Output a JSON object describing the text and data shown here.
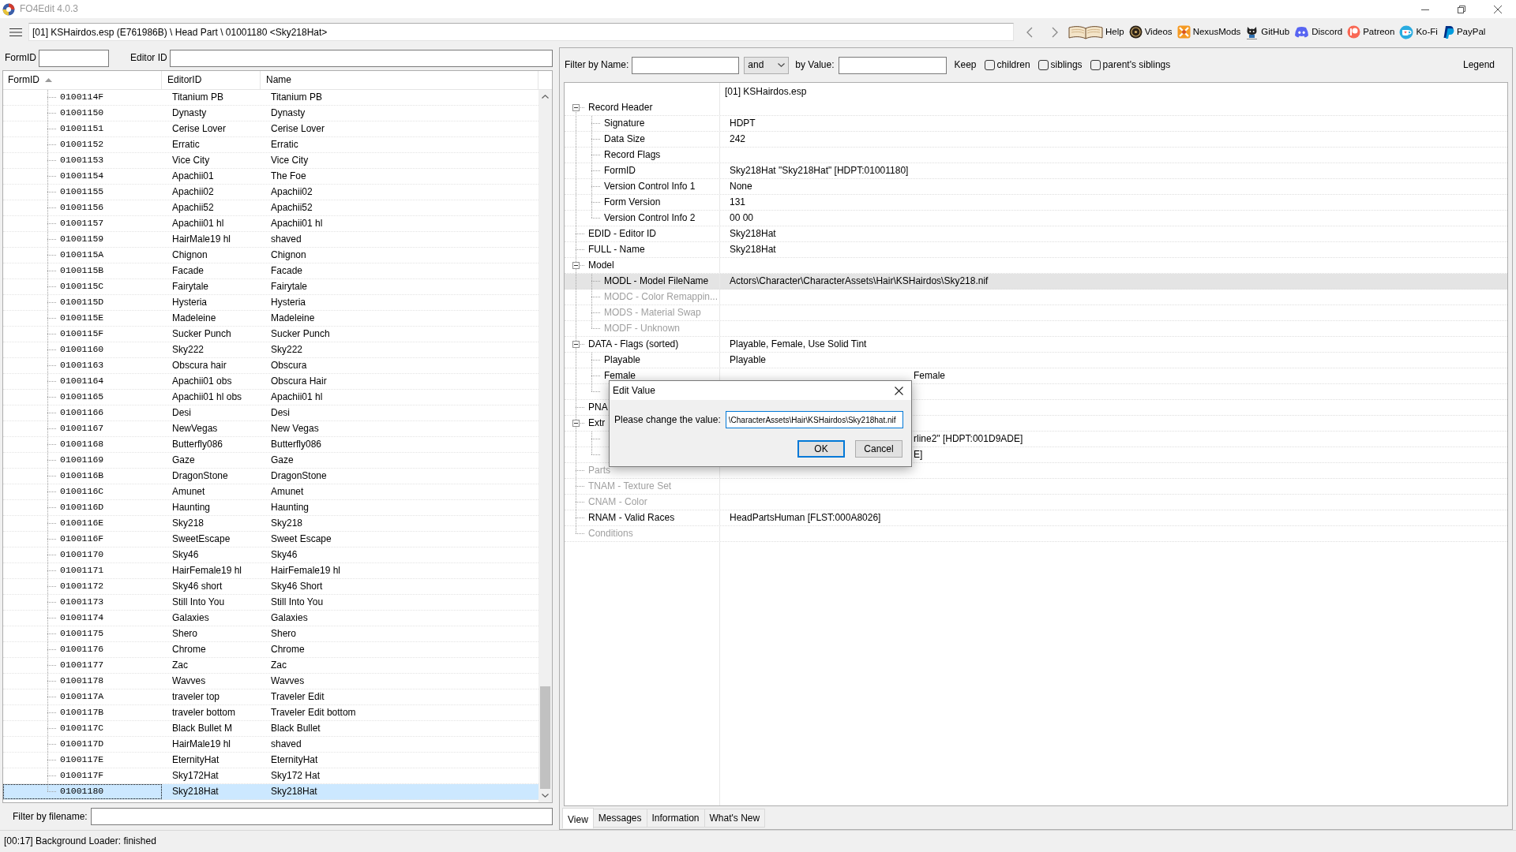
{
  "window": {
    "title": "FO4Edit 4.0.3"
  },
  "toolbar": {
    "path": "[01] KSHairdos.esp (E761986B) \\ Head Part \\ 01001180 <Sky218Hat>",
    "links": [
      {
        "kind": "help",
        "label": "Help"
      },
      {
        "kind": "videos",
        "label": "Videos"
      },
      {
        "kind": "nexusmods",
        "label": "NexusMods"
      },
      {
        "kind": "github",
        "label": "GitHub"
      },
      {
        "kind": "discord",
        "label": "Discord"
      },
      {
        "kind": "patreon",
        "label": "Patreon"
      },
      {
        "kind": "kofi",
        "label": "Ko-Fi"
      },
      {
        "kind": "paypal",
        "label": "PayPal"
      }
    ]
  },
  "record_filter": {
    "form_id_label": "FormID",
    "editor_id_label": "Editor ID"
  },
  "records": {
    "columns": [
      {
        "label": "FormID",
        "sorted": true
      },
      {
        "label": "EditorID",
        "sorted": false
      },
      {
        "label": "Name",
        "sorted": false
      }
    ],
    "rows": [
      {
        "form_id": "0100114F",
        "editor_id": "Titanium PB",
        "name": "Titanium PB",
        "selected": false
      },
      {
        "form_id": "01001150",
        "editor_id": "Dynasty",
        "name": "Dynasty",
        "selected": false
      },
      {
        "form_id": "01001151",
        "editor_id": "Cerise Lover",
        "name": "Cerise Lover",
        "selected": false
      },
      {
        "form_id": "01001152",
        "editor_id": "Erratic",
        "name": "Erratic",
        "selected": false
      },
      {
        "form_id": "01001153",
        "editor_id": "Vice City",
        "name": "Vice City",
        "selected": false
      },
      {
        "form_id": "01001154",
        "editor_id": "Apachii01",
        "name": "The Foe",
        "selected": false
      },
      {
        "form_id": "01001155",
        "editor_id": "Apachii02",
        "name": "Apachii02",
        "selected": false
      },
      {
        "form_id": "01001156",
        "editor_id": "Apachii52",
        "name": "Apachii52",
        "selected": false
      },
      {
        "form_id": "01001157",
        "editor_id": "Apachii01 hl",
        "name": "Apachii01 hl",
        "selected": false
      },
      {
        "form_id": "01001159",
        "editor_id": "HairMale19 hl",
        "name": "shaved",
        "selected": false
      },
      {
        "form_id": "0100115A",
        "editor_id": "Chignon",
        "name": "Chignon",
        "selected": false
      },
      {
        "form_id": "0100115B",
        "editor_id": "Facade",
        "name": "Facade",
        "selected": false
      },
      {
        "form_id": "0100115C",
        "editor_id": "Fairytale",
        "name": "Fairytale",
        "selected": false
      },
      {
        "form_id": "0100115D",
        "editor_id": "Hysteria",
        "name": "Hysteria",
        "selected": false
      },
      {
        "form_id": "0100115E",
        "editor_id": "Madeleine",
        "name": "Madeleine",
        "selected": false
      },
      {
        "form_id": "0100115F",
        "editor_id": "Sucker Punch",
        "name": "Sucker Punch",
        "selected": false
      },
      {
        "form_id": "01001160",
        "editor_id": "Sky222",
        "name": "Sky222",
        "selected": false
      },
      {
        "form_id": "01001163",
        "editor_id": "Obscura hair",
        "name": "Obscura",
        "selected": false
      },
      {
        "form_id": "01001164",
        "editor_id": "Apachii01 obs",
        "name": "Obscura Hair",
        "selected": false
      },
      {
        "form_id": "01001165",
        "editor_id": "Apachii01 hl obs",
        "name": "Apachii01 hl",
        "selected": false
      },
      {
        "form_id": "01001166",
        "editor_id": "Desi",
        "name": "Desi",
        "selected": false
      },
      {
        "form_id": "01001167",
        "editor_id": "NewVegas",
        "name": "New Vegas",
        "selected": false
      },
      {
        "form_id": "01001168",
        "editor_id": "Butterfly086",
        "name": "Butterfly086",
        "selected": false
      },
      {
        "form_id": "01001169",
        "editor_id": "Gaze",
        "name": "Gaze",
        "selected": false
      },
      {
        "form_id": "0100116B",
        "editor_id": "DragonStone",
        "name": "DragonStone",
        "selected": false
      },
      {
        "form_id": "0100116C",
        "editor_id": "Amunet",
        "name": "Amunet",
        "selected": false
      },
      {
        "form_id": "0100116D",
        "editor_id": "Haunting",
        "name": "Haunting",
        "selected": false
      },
      {
        "form_id": "0100116E",
        "editor_id": "Sky218",
        "name": "Sky218",
        "selected": false
      },
      {
        "form_id": "0100116F",
        "editor_id": "SweetEscape",
        "name": "Sweet Escape",
        "selected": false
      },
      {
        "form_id": "01001170",
        "editor_id": "Sky46",
        "name": "Sky46",
        "selected": false
      },
      {
        "form_id": "01001171",
        "editor_id": "HairFemale19 hl",
        "name": "HairFemale19 hl",
        "selected": false
      },
      {
        "form_id": "01001172",
        "editor_id": "Sky46 short",
        "name": "Sky46 Short",
        "selected": false
      },
      {
        "form_id": "01001173",
        "editor_id": "Still Into You",
        "name": "Still Into You",
        "selected": false
      },
      {
        "form_id": "01001174",
        "editor_id": "Galaxies",
        "name": "Galaxies",
        "selected": false
      },
      {
        "form_id": "01001175",
        "editor_id": "Shero",
        "name": "Shero",
        "selected": false
      },
      {
        "form_id": "01001176",
        "editor_id": "Chrome",
        "name": "Chrome",
        "selected": false
      },
      {
        "form_id": "01001177",
        "editor_id": "Zac",
        "name": "Zac",
        "selected": false
      },
      {
        "form_id": "01001178",
        "editor_id": "Wavves",
        "name": "Wavves",
        "selected": false
      },
      {
        "form_id": "0100117A",
        "editor_id": "traveler top",
        "name": "Traveler Edit",
        "selected": false
      },
      {
        "form_id": "0100117B",
        "editor_id": "traveler bottom",
        "name": "Traveler Edit bottom",
        "selected": false
      },
      {
        "form_id": "0100117C",
        "editor_id": "Black Bullet M",
        "name": "Black Bullet",
        "selected": false
      },
      {
        "form_id": "0100117D",
        "editor_id": "HairMale19 hl",
        "name": "shaved",
        "selected": false
      },
      {
        "form_id": "0100117E",
        "editor_id": "EternityHat",
        "name": "EternityHat",
        "selected": false
      },
      {
        "form_id": "0100117F",
        "editor_id": "Sky172Hat",
        "name": "Sky172 Hat",
        "selected": false
      },
      {
        "form_id": "01001180",
        "editor_id": "Sky218Hat",
        "name": "Sky218Hat",
        "selected": true
      }
    ]
  },
  "file_filter": {
    "label": "Filter by filename:"
  },
  "view_filter": {
    "name_label": "Filter by Name:",
    "operator": "and",
    "value_label": "by Value:",
    "keep_label": "Keep",
    "keep_options": [
      {
        "label": "children",
        "checked": false
      },
      {
        "label": "siblings",
        "checked": false
      },
      {
        "label": "parent's siblings",
        "checked": false
      }
    ],
    "legend": "Legend"
  },
  "record_view": {
    "header": "[01] KSHairdos.esp",
    "nodes": [
      {
        "label": "Record Header",
        "expanded": true,
        "selected": false,
        "disabled": false,
        "children": [
          {
            "label": "Signature",
            "value": "HDPT",
            "selected": false,
            "disabled": false
          },
          {
            "label": "Data Size",
            "value": "242",
            "selected": false,
            "disabled": false
          },
          {
            "label": "Record Flags",
            "selected": false,
            "disabled": false
          },
          {
            "label": "FormID",
            "value": "Sky218Hat \"Sky218Hat\" [HDPT:01001180]",
            "selected": false,
            "disabled": false
          },
          {
            "label": "Version Control Info 1",
            "value": "None",
            "selected": false,
            "disabled": false
          },
          {
            "label": "Form Version",
            "value": "131",
            "selected": false,
            "disabled": false
          },
          {
            "label": "Version Control Info 2",
            "value": "00 00",
            "selected": false,
            "disabled": false
          }
        ]
      },
      {
        "label": "EDID - Editor ID",
        "value": "Sky218Hat",
        "selected": false,
        "disabled": false
      },
      {
        "label": "FULL - Name",
        "value": "Sky218Hat",
        "selected": false,
        "disabled": false
      },
      {
        "label": "Model",
        "expanded": true,
        "selected": false,
        "disabled": false,
        "children": [
          {
            "label": "MODL - Model FileName",
            "value": "Actors\\Character\\CharacterAssets\\Hair\\KSHairdos\\Sky218.nif",
            "selected": true,
            "disabled": false
          },
          {
            "label": "MODC - Color Remappin...",
            "selected": false,
            "disabled": true
          },
          {
            "label": "MODS - Material Swap",
            "selected": false,
            "disabled": true
          },
          {
            "label": "MODF - Unknown",
            "selected": false,
            "disabled": true
          }
        ]
      },
      {
        "label": "DATA - Flags (sorted)",
        "value": "Playable, Female, Use Solid Tint",
        "expanded": true,
        "selected": false,
        "disabled": false,
        "children": [
          {
            "label": "Playable",
            "value": "Playable",
            "selected": false,
            "disabled": false
          },
          {
            "label": "Female",
            "value": "Female",
            "selected": false,
            "disabled": false
          },
          {
            "selected": false
          }
        ]
      },
      {
        "label": "PNA",
        "selected": false,
        "disabled": false
      },
      {
        "label": "Extr",
        "expanded": true,
        "selected": false,
        "disabled": false,
        "children": [
          {
            "value": "rline2\" [HDPT:001D9ADE]",
            "selected": false,
            "disabled": false
          },
          {
            "value": "E]",
            "selected": false,
            "disabled": false
          }
        ]
      },
      {
        "label": "Parts",
        "selected": false,
        "disabled": true
      },
      {
        "label": "TNAM - Texture Set",
        "selected": false,
        "disabled": true
      },
      {
        "label": "CNAM - Color",
        "selected": false,
        "disabled": true
      },
      {
        "label": "RNAM - Valid Races",
        "value": "HeadPartsHuman [FLST:000A8026]",
        "selected": false,
        "disabled": false
      },
      {
        "label": "Conditions",
        "selected": false,
        "disabled": true
      }
    ]
  },
  "tabs": [
    {
      "label": "View",
      "selected": true
    },
    {
      "label": "Messages",
      "selected": false
    },
    {
      "label": "Information",
      "selected": false
    },
    {
      "label": "What's New",
      "selected": false
    }
  ],
  "dialog": {
    "title": "Edit Value",
    "prompt": "Please change the value:",
    "value": "\\CharacterAssets\\Hair\\KSHairdos\\Sky218hat.nif",
    "buttons": [
      {
        "label": "OK",
        "default": true
      },
      {
        "label": "Cancel",
        "default": false
      }
    ]
  },
  "status_bar": {
    "message": "[00:17] Background Loader: finished"
  }
}
